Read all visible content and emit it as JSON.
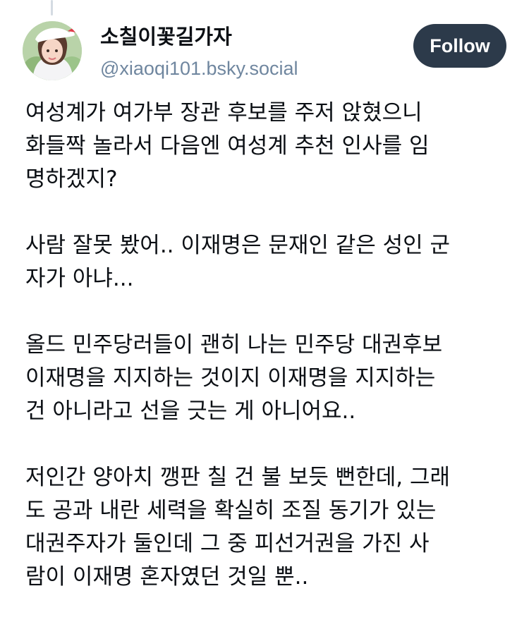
{
  "author": {
    "display_name": "소칠이꽃길가자",
    "handle": "@xiaoqi101.bsky.social",
    "avatar_icon": "profile-photo-avatar"
  },
  "follow_label": "Follow",
  "post": {
    "paragraphs": [
      "여성계가 여가부 장관 후보를 주저 앉혔으니\n화들짝 놀라서 다음엔 여성계 추천 인사를 임\n명하겠지?",
      "사람 잘못 봤어.. 이재명은 문재인 같은 성인 군\n자가 아냐...",
      "올드 민주당러들이 괜히 나는 민주당 대권후보\n이재명을 지지하는 것이지 이재명을 지지하는\n건 아니라고 선을 긋는 게 아니어요..",
      "저인간 양아치 깽판 칠 건 불 보듯 뻔한데, 그래\n도 공과 내란 세력을 확실히 조질 동기가 있는\n대권주자가 둘인데 그 중 피선거권을 가진 사\n람이 이재명 혼자였던 것일 뿐.."
    ]
  },
  "colors": {
    "follow_bg": "#2c3a4a",
    "handle": "#6f869f",
    "text": "#0b0f14"
  }
}
